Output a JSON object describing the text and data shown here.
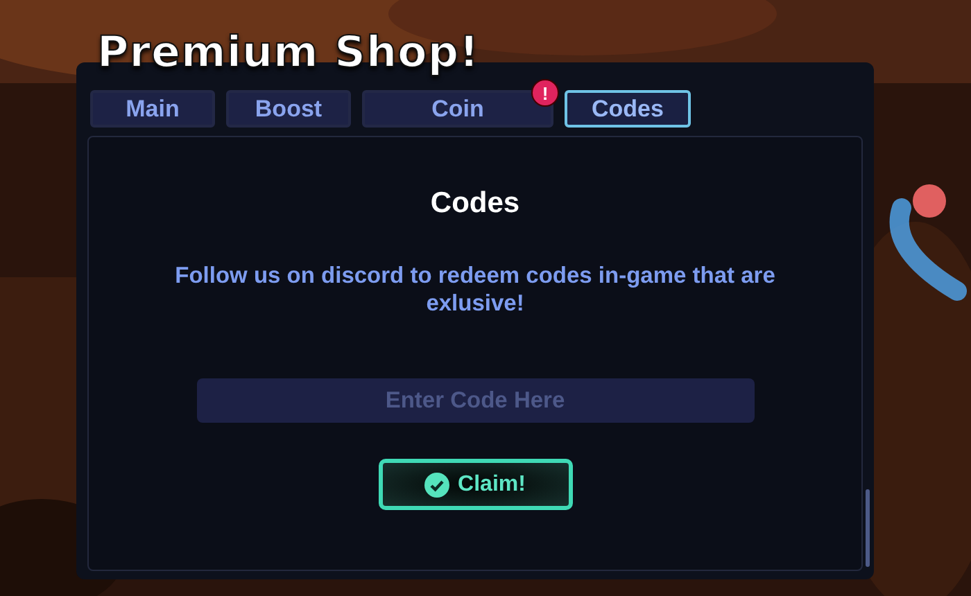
{
  "title": "Premium Shop!",
  "tabs": [
    {
      "label": "Main",
      "selected": false,
      "alert": false
    },
    {
      "label": "Boost",
      "selected": false,
      "alert": false
    },
    {
      "label": "Coin",
      "selected": false,
      "alert": true,
      "badge": "!"
    },
    {
      "label": "Codes",
      "selected": true,
      "alert": false
    }
  ],
  "panel": {
    "heading": "Codes",
    "message": "Follow us on discord to redeem codes in-game that are exlusive!",
    "code_field": {
      "placeholder": "Enter Code Here"
    },
    "claim_button": "Claim!"
  }
}
